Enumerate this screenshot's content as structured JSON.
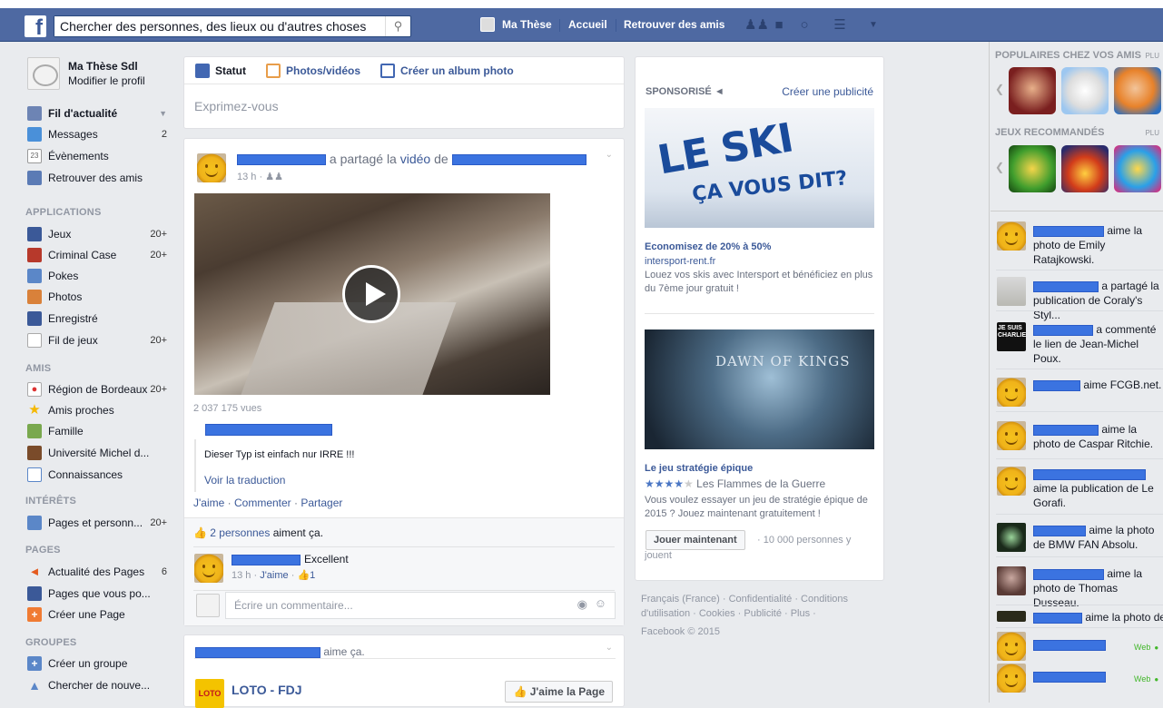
{
  "header": {
    "search_placeholder": "Chercher des personnes, des lieux ou d'autres choses",
    "profile_name": "Ma Thèse",
    "home": "Accueil",
    "find_friends": "Retrouver des amis"
  },
  "sidebar": {
    "profile_name": "Ma Thèse Sdl",
    "edit_profile": "Modifier le profil",
    "items": [
      {
        "label": "Fil d'actualité",
        "count": ""
      },
      {
        "label": "Messages",
        "count": "2"
      },
      {
        "label": "Évènements",
        "count": ""
      },
      {
        "label": "Retrouver des amis",
        "count": ""
      }
    ],
    "applications_title": "APPLICATIONS",
    "applications": [
      {
        "label": "Jeux",
        "count": "20+"
      },
      {
        "label": "Criminal Case",
        "count": "20+"
      },
      {
        "label": "Pokes",
        "count": ""
      },
      {
        "label": "Photos",
        "count": ""
      },
      {
        "label": "Enregistré",
        "count": ""
      },
      {
        "label": "Fil de jeux",
        "count": "20+"
      }
    ],
    "friends_title": "AMIS",
    "friends": [
      {
        "label": "Région de Bordeaux",
        "count": "20+"
      },
      {
        "label": "Amis proches",
        "count": ""
      },
      {
        "label": "Famille",
        "count": ""
      },
      {
        "label": "Université Michel d...",
        "count": ""
      },
      {
        "label": "Connaissances",
        "count": ""
      }
    ],
    "interests_title": "INTÉRÊTS",
    "interests": [
      {
        "label": "Pages et personn...",
        "count": "20+"
      }
    ],
    "pages_title": "PAGES",
    "pages": [
      {
        "label": "Actualité des Pages",
        "count": "6"
      },
      {
        "label": "Pages que vous po...",
        "count": ""
      },
      {
        "label": "Créer une Page",
        "count": ""
      }
    ],
    "groups_title": "GROUPES",
    "groups": [
      {
        "label": "Créer un groupe",
        "count": ""
      },
      {
        "label": "Chercher de nouve...",
        "count": ""
      }
    ]
  },
  "composer": {
    "tab_status": "Statut",
    "tab_photos": "Photos/vidéos",
    "tab_album": "Créer un album photo",
    "placeholder": "Exprimez-vous"
  },
  "post": {
    "shared_text": "a partagé la",
    "video_word": "vidéo",
    "of_word": "de",
    "time": "13 h ·",
    "views": "2 037 175 vues",
    "quote": "Dieser Typ ist einfach nur IRRE !!!",
    "translate": "Voir la traduction",
    "like": "J'aime",
    "comment": "Commenter",
    "share": "Partager",
    "likes_people": "2 personnes",
    "likes_suffix": "aiment ça.",
    "comment_text": "Excellent",
    "comment_time": "13 h ·",
    "comment_like": "J'aime",
    "comment_likes_count": "1",
    "write_comment_placeholder": "Écrire un commentaire..."
  },
  "post2": {
    "likes_text": "aime ça.",
    "page_name": "LOTO - FDJ",
    "like_page": "J'aime la Page"
  },
  "ads": {
    "sponsored": "SPONSORISÉ",
    "create_ad": "Créer une publicité",
    "ad1": {
      "image_text_1": "LE SKI",
      "image_text_2": "ÇA VOUS DIT?",
      "title": "Economisez de 20% à 50%",
      "domain": "intersport-rent.fr",
      "body": "Louez vos skis avec Intersport et bénéficiez en plus du 7ème jour gratuit !"
    },
    "ad2": {
      "image_title": "DAWN OF KINGS",
      "title": "Le jeu stratégie épique",
      "game_name": "Les Flammes de la Guerre",
      "stars": 3.5,
      "body": "Vous voulez essayer un jeu de stratégie épique de 2015 ? Jouez maintenant gratuitement !",
      "button": "Jouer maintenant",
      "players": "· 10 000 personnes y jouent"
    },
    "footer": "Français (France) · Confidentialité · Conditions d'utilisation · Cookies · Publicité · Plus ·",
    "copyright": "Facebook © 2015"
  },
  "right": {
    "popular_title": "POPULAIRES CHEZ VOS AMIS",
    "more1": "PLU",
    "recommended_title": "JEUX RECOMMANDÉS",
    "more2": "PLU",
    "ticker": [
      {
        "text": "aime la photo de Emily Ratajkowski."
      },
      {
        "text": "a partagé la publication de Coraly's Styl..."
      },
      {
        "text": "a commenté le lien de Jean-Michel Poux."
      },
      {
        "text": "aime FCGB.net."
      },
      {
        "text": "aime la photo de Caspar Ritchie."
      },
      {
        "text": "aime la publication de Le Gorafi."
      },
      {
        "text": "aime la photo de BMW FAN Absolu."
      },
      {
        "text": "aime la photo de Thomas Dusseau."
      },
      {
        "text": "aime la photo de"
      }
    ],
    "web1": "Web",
    "web2": "Web"
  }
}
